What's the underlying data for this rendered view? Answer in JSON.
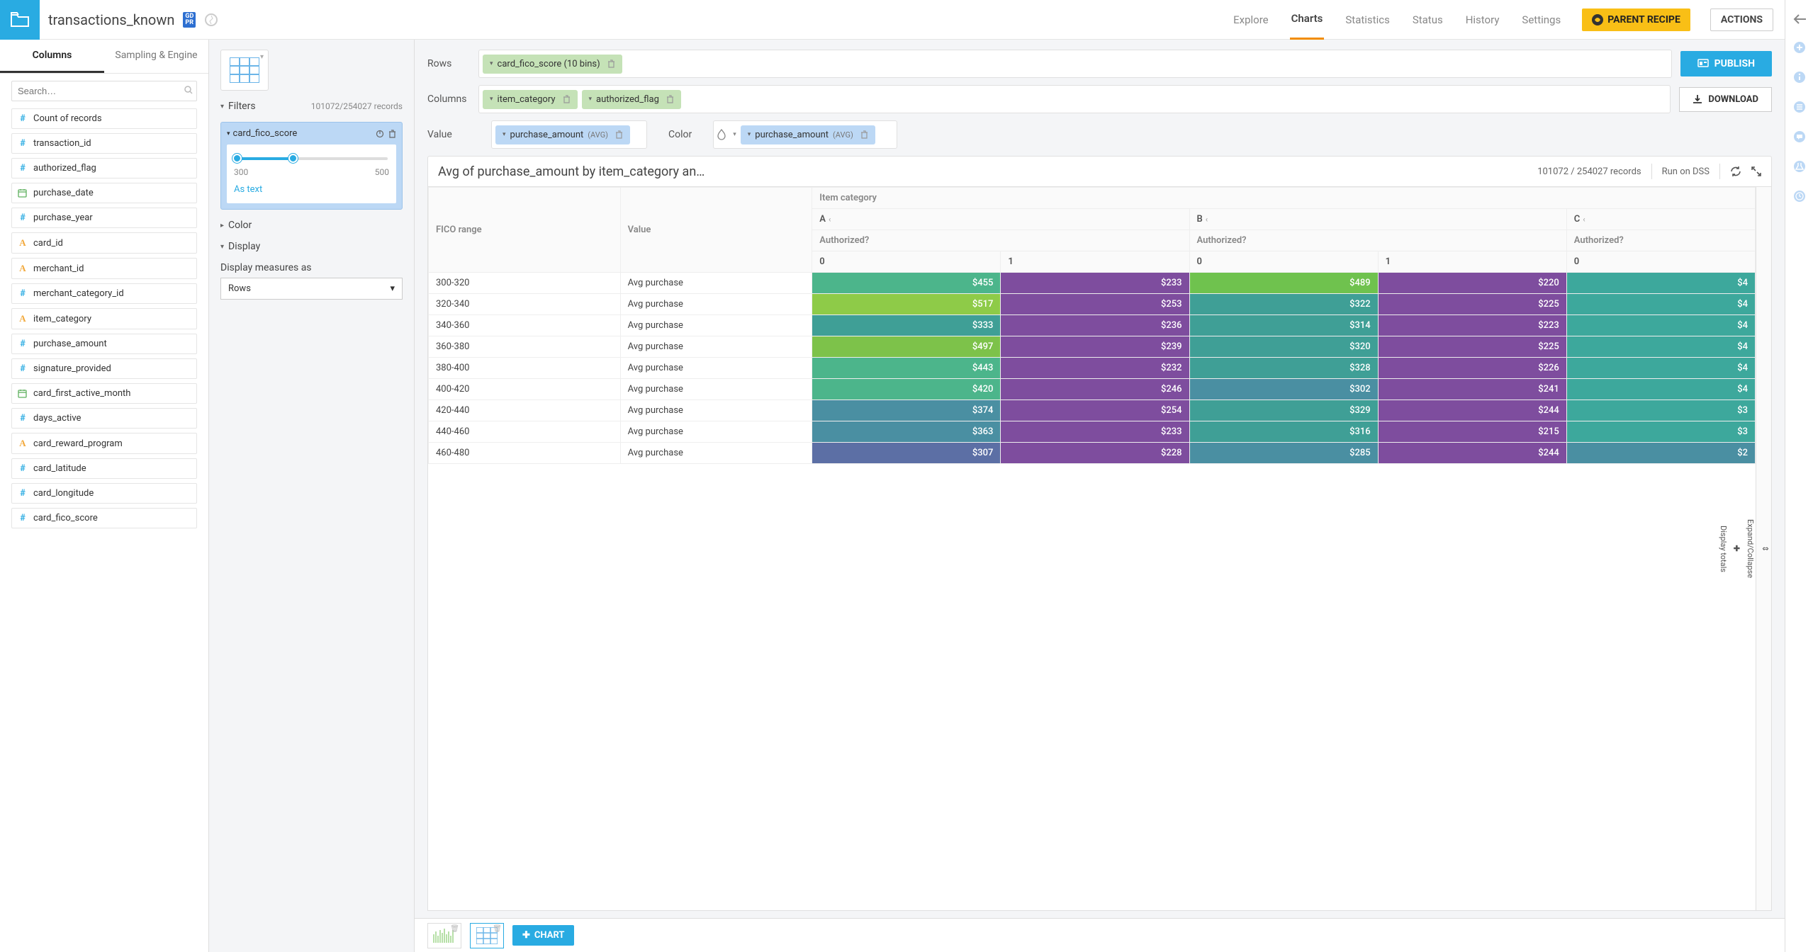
{
  "dataset_name": "transactions_known",
  "gdpr_badge": "GD PR",
  "topnav": {
    "explore": "Explore",
    "charts": "Charts",
    "statistics": "Statistics",
    "status": "Status",
    "history": "History",
    "settings": "Settings"
  },
  "buttons": {
    "parent_recipe": "PARENT RECIPE",
    "actions": "ACTIONS",
    "publish": "PUBLISH",
    "download": "DOWNLOAD",
    "add_chart": "CHART"
  },
  "sidebar": {
    "tabs": {
      "columns": "Columns",
      "sampling": "Sampling & Engine"
    },
    "search_placeholder": "Search…",
    "columns": [
      {
        "type": "hash",
        "name": "Count of records"
      },
      {
        "type": "hash",
        "name": "transaction_id"
      },
      {
        "type": "hash",
        "name": "authorized_flag"
      },
      {
        "type": "date",
        "name": "purchase_date"
      },
      {
        "type": "hash",
        "name": "purchase_year"
      },
      {
        "type": "a",
        "name": "card_id"
      },
      {
        "type": "a",
        "name": "merchant_id"
      },
      {
        "type": "hash",
        "name": "merchant_category_id"
      },
      {
        "type": "a",
        "name": "item_category"
      },
      {
        "type": "hash",
        "name": "purchase_amount"
      },
      {
        "type": "hash",
        "name": "signature_provided"
      },
      {
        "type": "date",
        "name": "card_first_active_month"
      },
      {
        "type": "hash",
        "name": "days_active"
      },
      {
        "type": "a",
        "name": "card_reward_program"
      },
      {
        "type": "hash",
        "name": "card_latitude"
      },
      {
        "type": "hash",
        "name": "card_longitude"
      },
      {
        "type": "hash",
        "name": "card_fico_score"
      }
    ]
  },
  "config": {
    "rows_label": "Rows",
    "columns_label": "Columns",
    "value_label": "Value",
    "color_label": "Color",
    "row_pill": "card_fico_score (10 bins)",
    "col_pill1": "item_category",
    "col_pill2": "authorized_flag",
    "val_pill": "purchase_amount",
    "avg": "(AVG)",
    "color_pill": "purchase_amount"
  },
  "filters": {
    "header": "Filters",
    "count": "101072/254027 records",
    "name": "card_fico_score",
    "min": "300",
    "max": "500",
    "as_text": "As text"
  },
  "color_section": "Color",
  "display": {
    "header": "Display",
    "label": "Display measures as",
    "value": "Rows"
  },
  "chart": {
    "title": "Avg of purchase_amount by item_category an…",
    "records": "101072 / 254027 records",
    "run_on": "Run on DSS"
  },
  "pivot": {
    "super_header": "Item category",
    "sub_cols": [
      "A",
      "B",
      "C"
    ],
    "authorized_header": "Authorized?",
    "fico_header": "FICO range",
    "value_header": "Value",
    "leaf_headers": [
      "0",
      "1",
      "0",
      "1",
      "0"
    ],
    "value_col_label": "Avg purchase"
  },
  "side": {
    "expand": "Expand/Collapse",
    "totals": "Display totals"
  },
  "chart_data": {
    "type": "table",
    "title": "Avg of purchase_amount by item_category and authorized_flag",
    "row_dim": "FICO range",
    "col_dims": [
      "Item category",
      "Authorized?"
    ],
    "measure": "Avg purchase",
    "columns": [
      {
        "item_category": "A",
        "authorized": "0"
      },
      {
        "item_category": "A",
        "authorized": "1"
      },
      {
        "item_category": "B",
        "authorized": "0"
      },
      {
        "item_category": "B",
        "authorized": "1"
      },
      {
        "item_category": "C",
        "authorized": "0"
      }
    ],
    "rows": [
      {
        "fico": "300-320",
        "vals": [
          "$455",
          "$233",
          "$489",
          "$220",
          "$4"
        ],
        "colors": [
          "#4cb58b",
          "#7e4d9e",
          "#6fc24e",
          "#7e4d9e",
          "#3da89c"
        ]
      },
      {
        "fico": "320-340",
        "vals": [
          "$517",
          "$253",
          "$322",
          "$225",
          "$4"
        ],
        "colors": [
          "#8ecb48",
          "#7e4d9e",
          "#3f9f96",
          "#7e4d9e",
          "#3da89c"
        ]
      },
      {
        "fico": "340-360",
        "vals": [
          "$333",
          "$236",
          "$314",
          "$223",
          "$4"
        ],
        "colors": [
          "#3f9f96",
          "#7e4d9e",
          "#3f9f96",
          "#7e4d9e",
          "#3da89c"
        ]
      },
      {
        "fico": "360-380",
        "vals": [
          "$497",
          "$239",
          "$320",
          "$225",
          "$4"
        ],
        "colors": [
          "#7dc24a",
          "#7e4d9e",
          "#3f9f96",
          "#7e4d9e",
          "#3da89c"
        ]
      },
      {
        "fico": "380-400",
        "vals": [
          "$443",
          "$232",
          "$328",
          "$226",
          "$4"
        ],
        "colors": [
          "#4cb58b",
          "#7e4d9e",
          "#3f9f96",
          "#7e4d9e",
          "#3da89c"
        ]
      },
      {
        "fico": "400-420",
        "vals": [
          "$420",
          "$246",
          "$302",
          "$241",
          "$4"
        ],
        "colors": [
          "#4cb58b",
          "#7e4d9e",
          "#4a8fa2",
          "#7e4d9e",
          "#3da89c"
        ]
      },
      {
        "fico": "420-440",
        "vals": [
          "$374",
          "$254",
          "$329",
          "$244",
          "$3"
        ],
        "colors": [
          "#4a8fa2",
          "#7e4d9e",
          "#3f9f96",
          "#7e4d9e",
          "#3da89c"
        ]
      },
      {
        "fico": "440-460",
        "vals": [
          "$363",
          "$233",
          "$316",
          "$215",
          "$3"
        ],
        "colors": [
          "#4a8fa2",
          "#7e4d9e",
          "#3f9f96",
          "#7e4d9e",
          "#3da89c"
        ]
      },
      {
        "fico": "460-480",
        "vals": [
          "$307",
          "$228",
          "$285",
          "$244",
          "$2"
        ],
        "colors": [
          "#5c6fa5",
          "#7e4d9e",
          "#4a8fa2",
          "#7e4d9e",
          "#4a8fa2"
        ]
      }
    ]
  }
}
